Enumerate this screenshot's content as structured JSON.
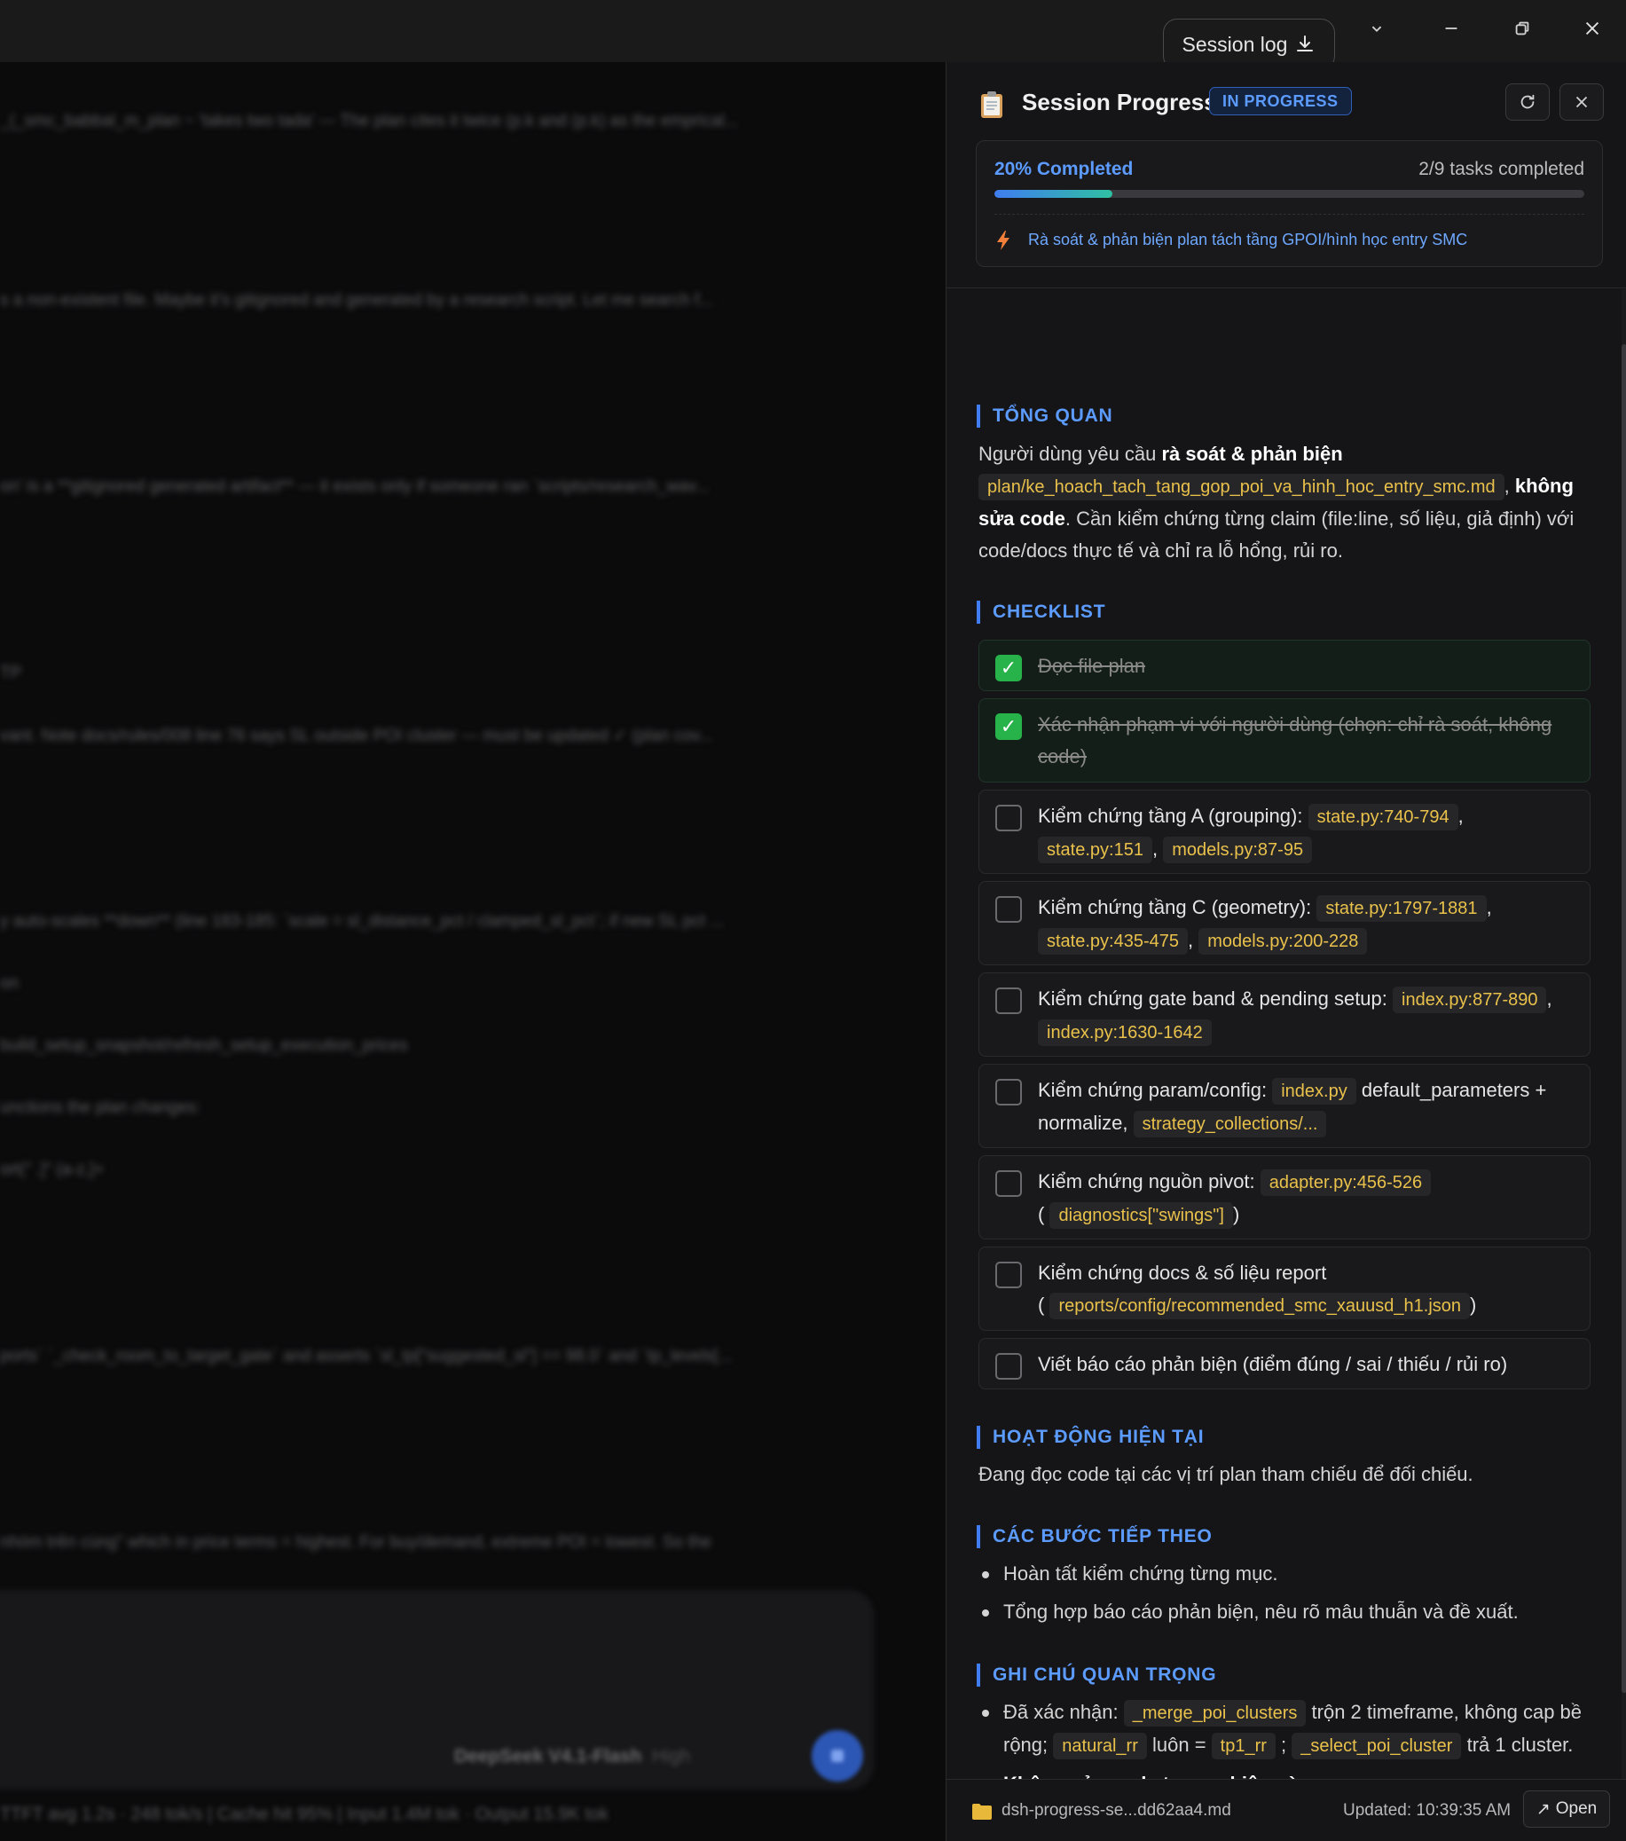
{
  "topbar": {
    "session_log_label": "Session log"
  },
  "background": {
    "lines": [
      "_(_smc_babbal_m_plan ~ 'takes two tada' — The plan cites it twice (p.k and (p.k) as the emprical...",
      "s a non-existent file. Maybe it's gitignored and generated by a research script. Let me search f...",
      "on' is a **gitignored generated artifact** — it exists only if someone ran `scripts/research_wav...",
      "TP",
      "vant. Note docs/rules/008 line 76 says SL outside POI cluster — must be updated ✓ (plan cov...",
      "y auto-scales **down** (line 183-185: `scale = sl_distance_pct / clamped_sl_pct`; if new SL pct ...",
      "on",
      "build_setup_snapshot/refresh_setup_execution_prices",
      "unctions the plan changes:",
      "ort(\" .]\" (a-z,]+",
      "ports` `_check_room_to_target_gate` and asserts `sl_tp[\"suggested_sl\"] == 98.0` and `tp_levels[...",
      "nhóm trên cùng\" which in price terms = highest. For buy/demand, extreme POI = lowest. So the"
    ],
    "model_name": "DeepSeek V4.1-Flash",
    "model_effort": "High",
    "status_bar": "TTFT avg 1.2s · 248 tok/s   |   Cache hit 95%   |   Input 1.4M tok · Output 15.9K tok"
  },
  "panel": {
    "title": "Session Progress",
    "status": "IN PROGRESS",
    "progress": {
      "percent": 20,
      "percent_label": "20% Completed",
      "tasks_label": "2/9 tasks completed",
      "current_task": "Rà soát & phản biện plan tách tầng GPOI/hình học entry SMC"
    },
    "overview": {
      "title": "TỔNG QUAN",
      "p1": "Người dùng yêu cầu ",
      "p1_bold": "rà soát & phản biện",
      "p1_code": "plan/ke_hoach_tach_tang_gop_poi_va_hinh_hoc_entry_smc.md",
      "p1_sep": ", ",
      "p1_bold2": "không sửa code",
      "p1_rest": ". Cần kiểm chứng từng claim (file:line, số liệu, giả định) với code/docs thực tế và chỉ ra lỗ hổng, rủi ro."
    },
    "checklist": {
      "title": "CHECKLIST",
      "items": [
        {
          "done": true,
          "text": "Đọc file plan"
        },
        {
          "done": true,
          "text": "Xác nhận phạm vi với người dùng (chọn: chỉ rà soát, không code)"
        },
        {
          "done": false,
          "text": "Kiểm chứng tầng A (grouping):",
          "codes": [
            "state.py:740-794",
            "state.py:151",
            "models.py:87-95"
          ]
        },
        {
          "done": false,
          "text": "Kiểm chứng tầng C (geometry):",
          "codes": [
            "state.py:1797-1881",
            "state.py:435-475",
            "models.py:200-228"
          ]
        },
        {
          "done": false,
          "text": "Kiểm chứng gate band & pending setup:",
          "codes": [
            "index.py:877-890",
            "index.py:1630-1642"
          ]
        },
        {
          "done": false,
          "text": "Kiểm chứng param/config:",
          "code_a": "index.py",
          "mid": " default_parameters + normalize, ",
          "code_b": "strategy_collections/..."
        },
        {
          "done": false,
          "text": "Kiểm chứng nguồn pivot:",
          "code_a": "adapter.py:456-526",
          "code_b": "diagnostics[\"swings\"]"
        },
        {
          "done": false,
          "text": "Kiểm chứng docs & số liệu report",
          "code_a": "reports/config/recommended_smc_xauusd_h1.json"
        },
        {
          "done": false,
          "text": "Viết báo cáo phản biện (điểm đúng / sai / thiếu / rủi ro)"
        }
      ]
    },
    "current_activity": {
      "title": "HOẠT ĐỘNG HIỆN TẠI",
      "text": "Đang đọc code tại các vị trí plan tham chiếu để đối chiếu."
    },
    "next_steps": {
      "title": "CÁC BƯỚC TIẾP THEO",
      "items": [
        "Hoàn tất kiểm chứng từng mục.",
        "Tổng hợp báo cáo phản biện, nêu rõ mâu thuẫn và đề xuất."
      ]
    },
    "notes": {
      "title": "GHI CHÚ QUAN TRỌNG",
      "n1_prefix": "Đã xác nhận: ",
      "n1_code1": "_merge_poi_clusters",
      "n1_mid1": " trộn 2 timeframe, không cap bề rộng; ",
      "n1_code2": "natural_rr",
      "n1_mid2": " luôn = ",
      "n1_code3": "tp1_rr",
      "n1_mid3": " ; ",
      "n1_code4": "_select_poi_cluster",
      "n1_end": " trả 1 cluster.",
      "n2": "Không sửa code trong phiên này."
    },
    "footer": {
      "file": "dsh-progress-se...dd62aa4.md",
      "updated": "Updated: 10:39:35 AM",
      "open_label": "Open"
    }
  }
}
